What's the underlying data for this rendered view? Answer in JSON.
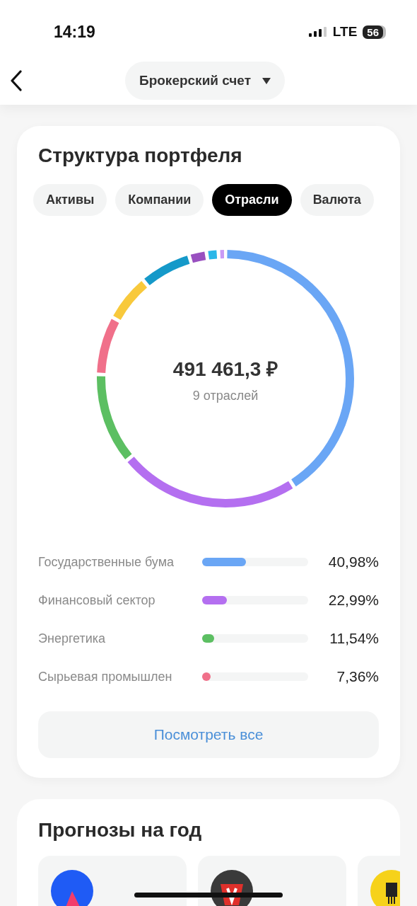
{
  "status_bar": {
    "time": "14:19",
    "network": "LTE",
    "battery": "56"
  },
  "header": {
    "account": "Брокерский счет"
  },
  "portfolio": {
    "title": "Структура портфеля",
    "tabs": [
      {
        "label": "Активы",
        "selected": false
      },
      {
        "label": "Компании",
        "selected": false
      },
      {
        "label": "Отрасли",
        "selected": true
      },
      {
        "label": "Валюта",
        "selected": false
      }
    ],
    "total": "491 461,3 ₽",
    "subtitle": "9 отраслей",
    "sectors": [
      {
        "name": "Государственные бума",
        "percent": "40,98%",
        "level": 0.41,
        "color": "#6aa6f5"
      },
      {
        "name": "Финансовый сектор",
        "percent": "22,99%",
        "level": 0.23,
        "color": "#b46ff0"
      },
      {
        "name": "Энергетика",
        "percent": "11,54%",
        "level": 0.11,
        "color": "#5cbf62"
      },
      {
        "name": "Сырьевая промышлен",
        "percent": "7,36%",
        "level": 0.07,
        "color": "#f0708a"
      }
    ],
    "show_all": "Посмотреть все"
  },
  "forecasts": {
    "title": "Прогнозы на год"
  }
}
